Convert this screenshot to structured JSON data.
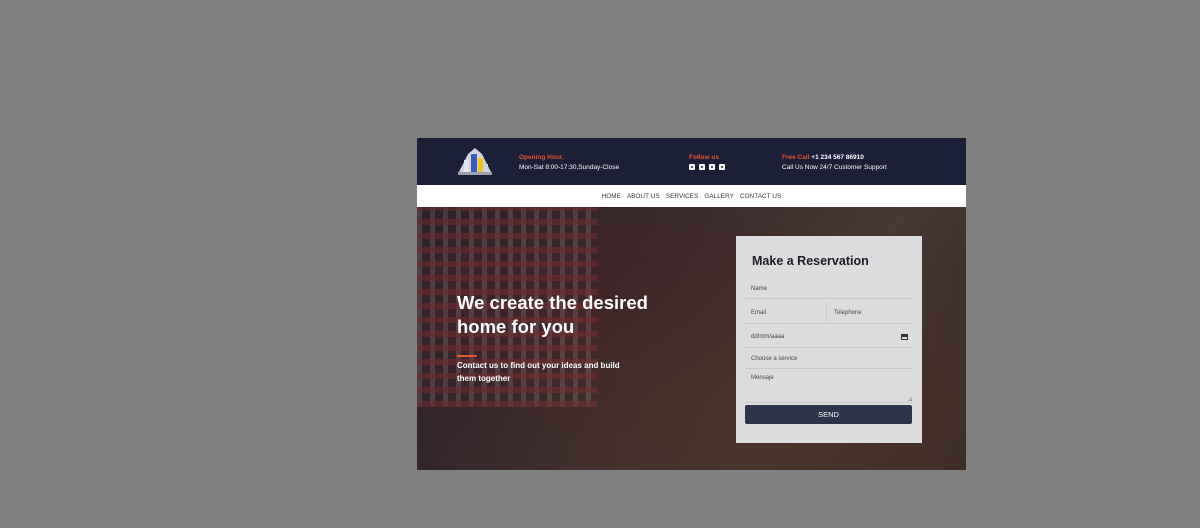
{
  "header": {
    "hours_label": "Opening Hour.",
    "hours_value": "Mon-Sat 8:00-17:30,Sunday-Close",
    "follow_label": "Follow us",
    "social_icons": [
      "facebook-icon",
      "twitter-icon",
      "instagram-icon",
      "linkedin-icon"
    ],
    "call_label": "Free Call",
    "phone": "+1 234 567 86910",
    "call_sub": "Call Us Now 24/7 Customer Support"
  },
  "nav": {
    "items": [
      "HOME",
      "ABOUT US",
      "SERVICES",
      "GALLERY",
      "CONTACT US"
    ]
  },
  "hero": {
    "title": "We create the desired home for you",
    "subtitle": "Contact us to find out your ideas and build them together"
  },
  "form": {
    "title": "Make a Reservation",
    "name_placeholder": "Name",
    "email_placeholder": "Email",
    "telephone_placeholder": "Telephone",
    "date_placeholder": "dd/mm/aaaa",
    "service_placeholder": "Choose a service",
    "message_placeholder": "Mensaje",
    "send_label": "SEND"
  },
  "colors": {
    "accent": "#e8542b",
    "header_bg": "#1b2038",
    "button_bg": "#2d344b",
    "page_bg": "#808080"
  }
}
